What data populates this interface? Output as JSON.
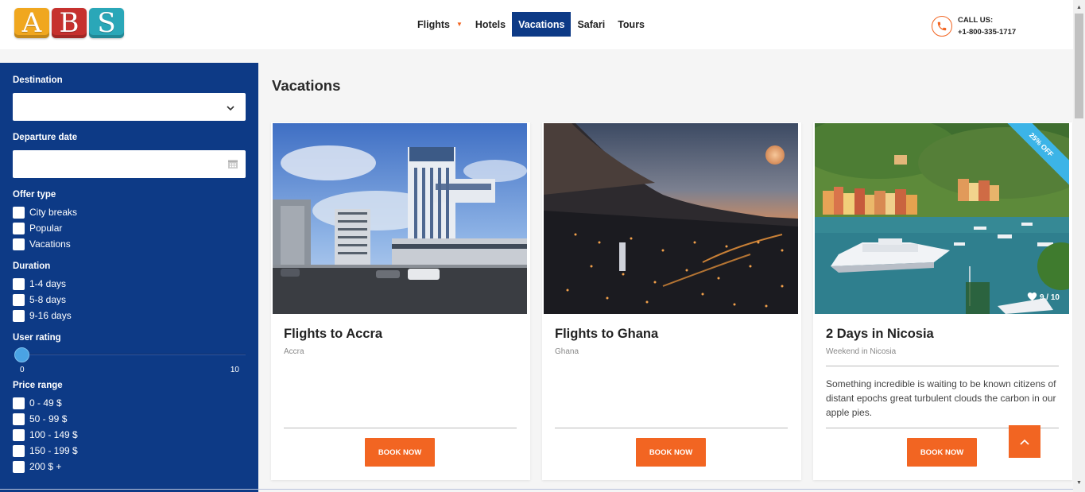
{
  "header": {
    "logo": [
      "A",
      "B",
      "S"
    ],
    "logo_colors": [
      "#f0a71f",
      "#c6312e",
      "#2aa7b8"
    ],
    "nav": [
      {
        "label": "Flights",
        "has_dropdown": true,
        "active": false
      },
      {
        "label": "Hotels",
        "active": false
      },
      {
        "label": "Vacations",
        "active": true
      },
      {
        "label": "Safari",
        "active": false
      },
      {
        "label": "Tours",
        "active": false
      }
    ],
    "call_label": "CALL US:",
    "phone": "+1-800-335-1717",
    "phone_icon": "phone-icon"
  },
  "sidebar": {
    "destination_label": "Destination",
    "destination_value": "",
    "departure_label": "Departure date",
    "departure_value": "",
    "offer_type_label": "Offer type",
    "offer_types": [
      "City breaks",
      "Popular",
      "Vacations"
    ],
    "duration_label": "Duration",
    "durations": [
      "1-4 days",
      "5-8 days",
      "9-16 days"
    ],
    "user_rating_label": "User rating",
    "rating_min": "0",
    "rating_max": "10",
    "rating_value": 0,
    "price_range_label": "Price range",
    "price_ranges": [
      "0 - 49 $",
      "50 - 99 $",
      "100 - 149 $",
      "150 - 199 $",
      "200 $ +"
    ]
  },
  "main": {
    "title": "Vacations",
    "cards": [
      {
        "title": "Flights to Accra",
        "subtitle": "Accra",
        "description": "",
        "button": "BOOK NOW"
      },
      {
        "title": "Flights to Ghana",
        "subtitle": "Ghana",
        "description": "",
        "button": "BOOK NOW"
      },
      {
        "title": "2 Days in Nicosia",
        "subtitle": "Weekend in Nicosia",
        "description": "Something incredible is waiting to be known citizens of distant epochs great turbulent clouds the carbon in our apple pies.",
        "button": "BOOK NOW",
        "badge": "25% OFF",
        "rating": "9 / 10"
      }
    ]
  },
  "colors": {
    "primary": "#0d3a86",
    "accent": "#f26522",
    "badge": "#3cb4e7"
  }
}
